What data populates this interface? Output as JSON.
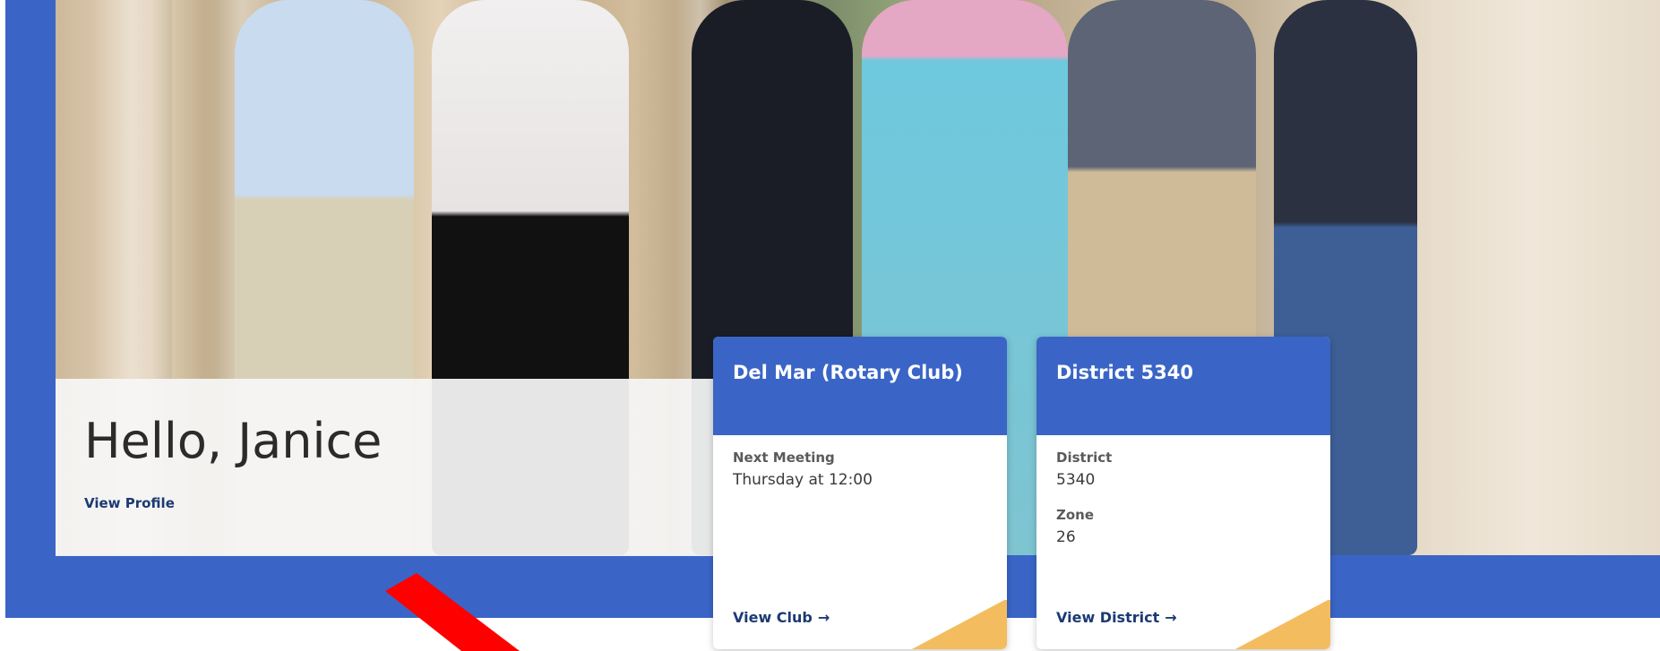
{
  "greeting": {
    "title": "Hello, Janice",
    "profile_link": "View Profile"
  },
  "club_card": {
    "title": "Del Mar (Rotary Club)",
    "next_meeting_label": "Next Meeting",
    "next_meeting_value": "Thursday at 12:00",
    "link": "View Club",
    "arrow": "→"
  },
  "district_card": {
    "title": "District 5340",
    "district_label": "District",
    "district_value": "5340",
    "zone_label": "Zone",
    "zone_value": "26",
    "link": "View District",
    "arrow": "→"
  },
  "colors": {
    "brand_blue": "#3a65c7",
    "link_navy": "#1b3a72",
    "accent_gold": "#f3bd5f",
    "annotation_red": "#ff0000"
  }
}
